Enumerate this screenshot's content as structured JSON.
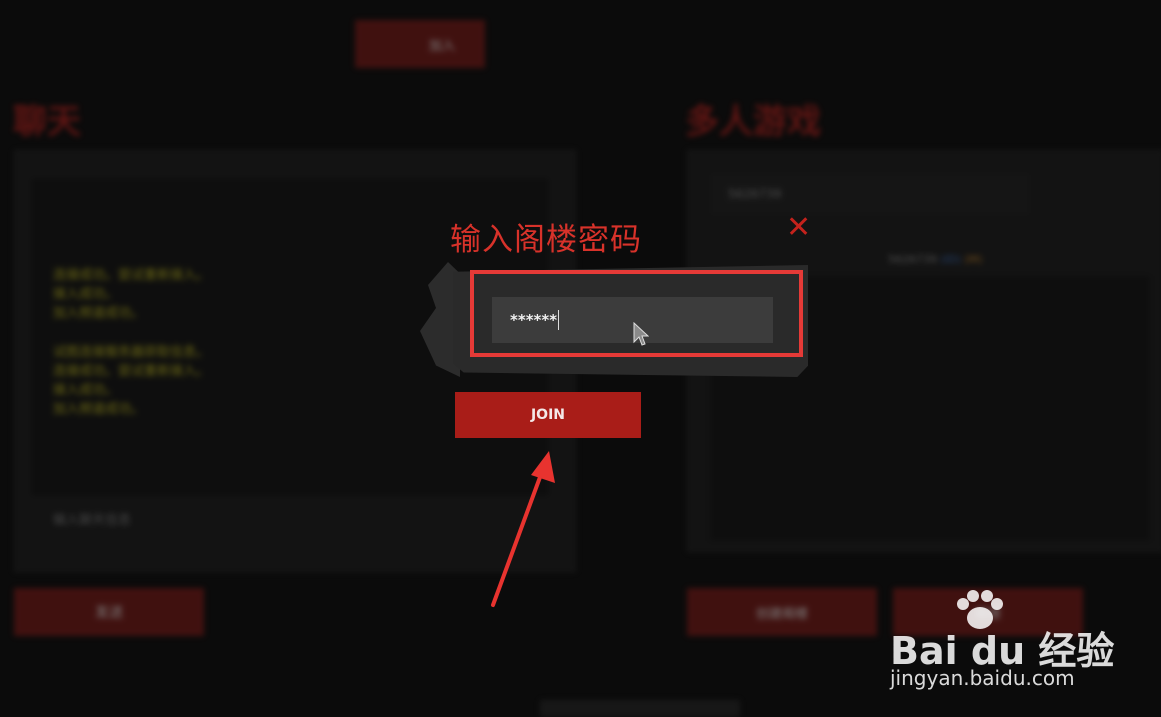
{
  "background": {
    "chat": {
      "title": "聊天",
      "lines_a": [
        "连接成功。尝试重新接入。",
        "接入成功。",
        "加入频道成功。"
      ],
      "lines_b": [
        "试图连接服务器获取信息。",
        "连接成功。尝试重新接入。",
        "接入成功。",
        "加入频道成功。"
      ],
      "input_placeholder": "输入聊天信息",
      "send_label": "发送"
    },
    "multiplayer": {
      "title": "多人游戏",
      "field_value": "5626739",
      "action_label": "加入",
      "player_name": "5626739",
      "player_tag_a": "(ID)",
      "player_tag_b": "(M)",
      "bottom_left_label": "创建阁楼",
      "bottom_right_label": "阁楼"
    }
  },
  "dialog": {
    "title": "输入阁楼密码",
    "password_value": "******",
    "join_label": "JOIN",
    "close_icon": "close-x-icon"
  },
  "watermark": {
    "brand": "Bai du 经验",
    "url": "jingyan.baidu.com"
  },
  "colors": {
    "accent_red": "#a91d18",
    "title_red": "#d8322a",
    "highlight_red": "#e53a37",
    "chat_text_yellow": "#b9b21c"
  }
}
